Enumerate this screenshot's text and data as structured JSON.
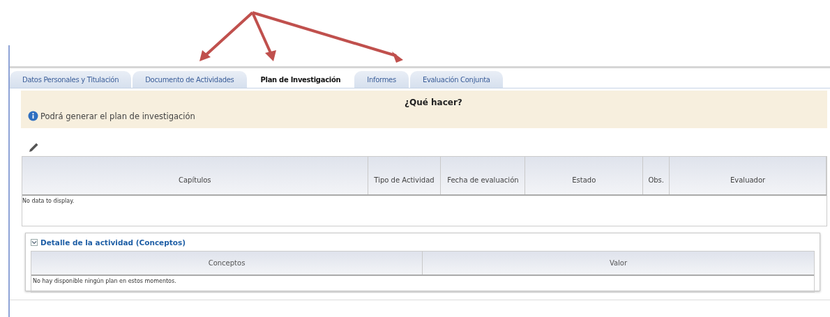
{
  "tabs": [
    {
      "label": "Datos Personales y Titulación",
      "selected": false
    },
    {
      "label": "Documento de Actividades",
      "selected": false
    },
    {
      "label": "Plan de Investigación",
      "selected": true
    },
    {
      "label": "Informes",
      "selected": false
    },
    {
      "label": "Evaluación Conjunta",
      "selected": false
    }
  ],
  "help": {
    "title": "¿Qué hacer?",
    "message": "Podrá generar el plan de investigación"
  },
  "table": {
    "columns": [
      "Capítulos",
      "Tipo de Actividad",
      "Fecha de evaluación",
      "Estado",
      "Obs.",
      "Evaluador"
    ],
    "empty_message": "No data to display."
  },
  "detail": {
    "title": "Detalle de la actividad (Conceptos)",
    "expanded": true,
    "columns": [
      "Conceptos",
      "Valor"
    ],
    "empty_message": "No hay disponible ningún plan en estos momentos."
  }
}
